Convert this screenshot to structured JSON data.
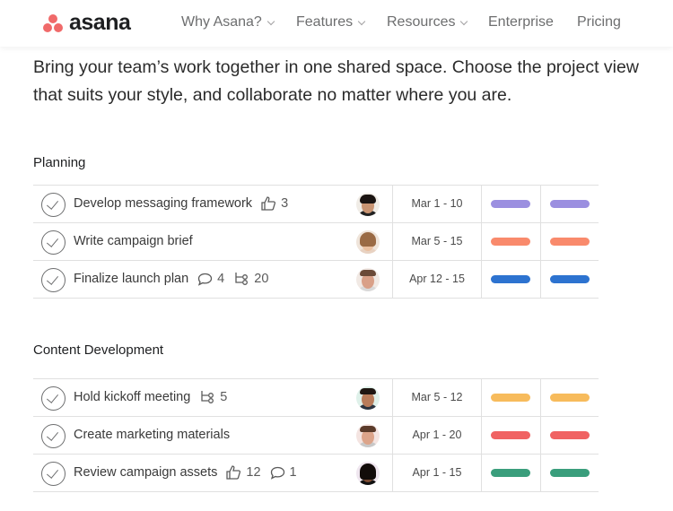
{
  "nav": {
    "logo": "asana",
    "items": [
      {
        "label": "Why Asana?",
        "dropdown": true
      },
      {
        "label": "Features",
        "dropdown": true
      },
      {
        "label": "Resources",
        "dropdown": true
      },
      {
        "label": "Enterprise",
        "dropdown": false
      },
      {
        "label": "Pricing",
        "dropdown": false
      }
    ]
  },
  "intro": "Bring your team’s work together in one shared space. Choose the project view that suits your style, and collaborate no matter where you are.",
  "colors": {
    "logo": "#f06a6a",
    "purple": "#9b8fe0",
    "coral": "#f98a6c",
    "blue": "#2d73d0",
    "yellow": "#f7bb5c",
    "red": "#f06262",
    "green": "#3a9e7c"
  },
  "sections": [
    {
      "title": "Planning",
      "rows": [
        {
          "task": "Develop messaging framework",
          "likes": "3",
          "date": "Mar 1 - 10",
          "color": "#9b8fe0",
          "avatar": "person-1"
        },
        {
          "task": "Write campaign brief",
          "date": "Mar 5 - 15",
          "color": "#f98a6c",
          "avatar": "person-2"
        },
        {
          "task": "Finalize launch plan",
          "comments": "4",
          "subtasks": "20",
          "date": "Apr 12 - 15",
          "color": "#2d73d0",
          "avatar": "person-3"
        }
      ]
    },
    {
      "title": "Content Development",
      "rows": [
        {
          "task": "Hold kickoff meeting",
          "subtasks": "5",
          "date": "Mar 5 - 12",
          "color": "#f7bb5c",
          "avatar": "person-4"
        },
        {
          "task": "Create marketing materials",
          "date": "Apr 1 - 20",
          "color": "#f06262",
          "avatar": "person-5"
        },
        {
          "task": "Review campaign assets",
          "likes": "12",
          "comments": "1",
          "date": "Apr 1 - 15",
          "color": "#3a9e7c",
          "avatar": "person-6"
        }
      ]
    }
  ]
}
